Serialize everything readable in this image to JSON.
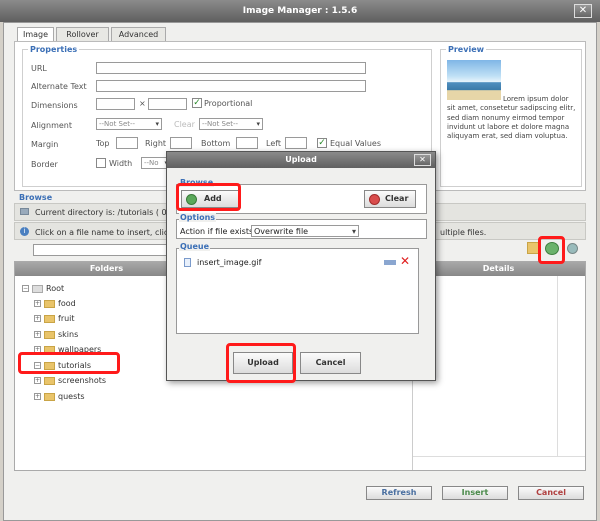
{
  "window": {
    "title": "Image Manager : 1.5.6"
  },
  "tabs": [
    {
      "label": "Image"
    },
    {
      "label": "Rollover"
    },
    {
      "label": "Advanced"
    }
  ],
  "properties": {
    "legend": "Properties",
    "url_label": "URL",
    "alt_label": "Alternate Text",
    "dimensions_label": "Dimensions",
    "dim_sep": "×",
    "proportional_label": "Proportional",
    "alignment_label": "Alignment",
    "align_value": "--Not Set--",
    "clear_label": "Clear",
    "clear_value": "--Not Set--",
    "margin_label": "Margin",
    "top_label": "Top",
    "right_label": "Right",
    "bottom_label": "Bottom",
    "left_label": "Left",
    "equal_label": "Equal Values",
    "border_label": "Border",
    "width_label": "Width",
    "width_value": "--No"
  },
  "preview": {
    "legend": "Preview",
    "text": "Lorem ipsum dolor sit amet, consetetur sadipscing elitr, sed diam nonumy eirmod tempor invidunt ut labore et dolore magna aliquyam erat, sed diam voluptua."
  },
  "browse": {
    "legend": "Browse",
    "current_dir": "Current directory is: /tutorials ( 0",
    "hint": "Click on a file name to insert, clic",
    "hint_tail": "ultiple files.",
    "folders_header": "Folders",
    "details_header": "Details",
    "tree": [
      {
        "label": "Root"
      },
      {
        "label": "food"
      },
      {
        "label": "fruit"
      },
      {
        "label": "skins"
      },
      {
        "label": "wallpapers"
      },
      {
        "label": "tutorials"
      },
      {
        "label": "screenshots"
      },
      {
        "label": "quests"
      }
    ]
  },
  "footer": {
    "refresh": "Refresh",
    "insert": "Insert",
    "cancel": "Cancel"
  },
  "upload": {
    "title": "Upload",
    "browse_legend": "Browse",
    "add_label": "Add",
    "clear_label": "Clear",
    "options_legend": "Options",
    "action_label": "Action if file exists:",
    "action_value": "Overwrite file",
    "queue_legend": "Queue",
    "queue_items": [
      {
        "name": "insert_image.gif"
      }
    ],
    "upload_btn": "Upload",
    "cancel_btn": "Cancel"
  },
  "colors": {
    "accent": "#3b6fb6",
    "highlight": "#ff1a1a"
  }
}
